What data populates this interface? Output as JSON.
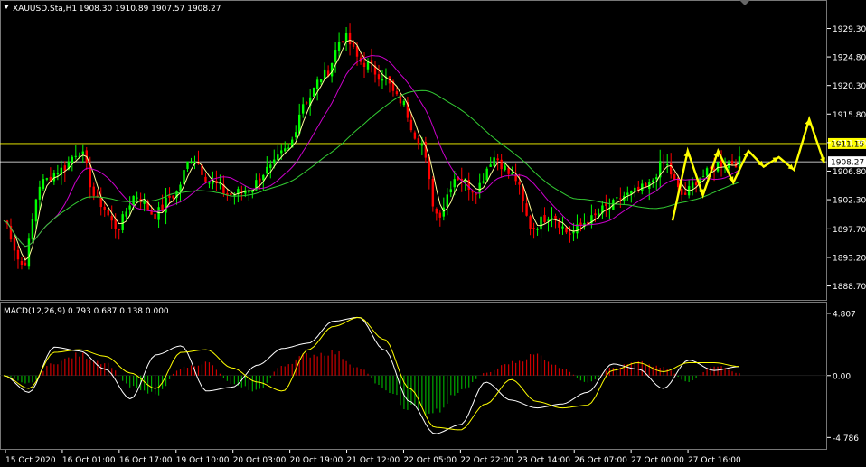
{
  "main_header": {
    "symbol": "XAUUSD.Sta,H1",
    "ohlc": "1908.30 1910.89 1907.57 1908.27"
  },
  "macd_header": {
    "name": "MACD(12,26,9)",
    "values": "0.793 0.687 0.138 0.000"
  },
  "price_axis": {
    "range": [
      1886.5,
      1933.5
    ],
    "ticks": [
      "1929.30",
      "1924.80",
      "1920.30",
      "1915.80",
      "1911.30",
      "1906.80",
      "1902.30",
      "1897.70",
      "1893.20",
      "1888.70"
    ]
  },
  "price_levels": [
    {
      "label": "1911.15",
      "value": 1911.15,
      "color": "#ffff00"
    },
    {
      "label": "1908.27",
      "value": 1908.27,
      "color": "#ffffff"
    }
  ],
  "macd_axis": {
    "top": "4.807",
    "zero": "0.00",
    "bottom": "-4.786",
    "range": [
      -4.786,
      4.807
    ]
  },
  "time_axis": [
    "15 Oct 2020",
    "16 Oct 01:00",
    "16 Oct 17:00",
    "19 Oct 10:00",
    "20 Oct 03:00",
    "20 Oct 19:00",
    "21 Oct 12:00",
    "22 Oct 05:00",
    "22 Oct 22:00",
    "23 Oct 14:00",
    "26 Oct 07:00",
    "27 Oct 00:00",
    "27 Oct 16:00"
  ],
  "colors": {
    "bull": "#00ff00",
    "bear": "#ff0000",
    "ma_fast": "#ffff99",
    "ma_mid": "#cc00cc",
    "ma_slow": "#33cc33",
    "forecast": "#ffff00",
    "hist_pos": "#cc0000",
    "hist_neg": "#00aa00"
  },
  "chart_data": [
    {
      "type": "candlestick",
      "title": "XAUUSD.Sta,H1",
      "ylim": [
        1888.7,
        1929.3
      ],
      "x_labels": [
        "15 Oct 2020",
        "16 Oct 01:00",
        "16 Oct 17:00",
        "19 Oct 10:00",
        "20 Oct 03:00",
        "20 Oct 19:00",
        "21 Oct 12:00",
        "22 Oct 05:00",
        "22 Oct 22:00",
        "23 Oct 14:00",
        "26 Oct 07:00",
        "27 Oct 00:00",
        "27 Oct 16:00"
      ],
      "anchors": [
        1899,
        1892,
        1905,
        1907,
        1910,
        1902,
        1898,
        1903,
        1900,
        1903,
        1909,
        1905,
        1903,
        1904,
        1907,
        1910,
        1918,
        1922,
        1928,
        1924,
        1922,
        1918,
        1912,
        1900,
        1906,
        1904,
        1909,
        1906,
        1898,
        1900,
        1897,
        1899,
        1901,
        1903,
        1904,
        1908,
        1903,
        1906,
        1908,
        1908.27
      ],
      "forecast_path": [
        1899,
        1910,
        1903,
        1910,
        1905,
        1910,
        1907.5,
        1909,
        1907,
        1915,
        1908
      ]
    },
    {
      "type": "macd",
      "title": "MACD(12,26,9)",
      "ylim": [
        -4.786,
        4.807
      ],
      "macd_anchors": [
        0,
        -1.3,
        2.2,
        1.9,
        0.5,
        -1.8,
        1.6,
        2.3,
        -1.2,
        -0.9,
        0.8,
        2.1,
        2.5,
        4.2,
        4.5,
        2.0,
        -2.0,
        -4.5,
        -3.8,
        -0.5,
        -1.9,
        -2.5,
        -2.2,
        -1.3,
        0.9,
        0.5,
        -1.0,
        1.2,
        0.4,
        0.7
      ],
      "signal_anchors": [
        0,
        -1.0,
        1.8,
        2.0,
        1.5,
        0.2,
        -1.0,
        1.8,
        2.0,
        0.6,
        -0.5,
        -1.2,
        2.0,
        3.8,
        4.5,
        2.8,
        -1.0,
        -4.0,
        -4.2,
        -2.2,
        -0.3,
        -2.0,
        -2.5,
        -2.3,
        0.4,
        1.0,
        0.3,
        1.0,
        1.0,
        0.7
      ],
      "hist_anchors": [
        0,
        -0.6,
        1.0,
        1.6,
        1.0,
        -0.8,
        -1.4,
        0.6,
        1.0,
        -0.6,
        -1.2,
        0.8,
        1.6,
        1.8,
        0.6,
        -1.0,
        -2.5,
        -2.8,
        -1.2,
        0.2,
        1.0,
        1.6,
        0.6,
        -0.6,
        0.6,
        1.0,
        0.6,
        -0.5,
        0.8,
        0.2
      ]
    }
  ]
}
